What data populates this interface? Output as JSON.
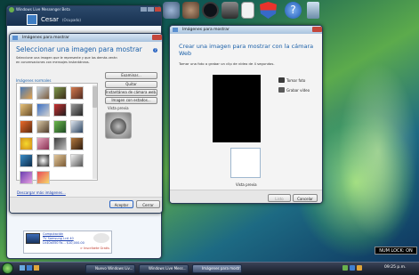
{
  "messenger": {
    "title": "Windows Live Messenger Beta",
    "user_name": "Cesar",
    "user_status": "(Ocupado)",
    "ad_line1": "Computación",
    "ad_line2": "TV Samsung Lcd 40",
    "ad_line3": "Ln40a550 Fa... $10,000.00",
    "ad_line4": "> Inscríbete Gratis"
  },
  "dialog1": {
    "title": "Imágenes para mostrar",
    "heading": "Seleccionar una imagen para mostrar",
    "description": "Seleccione una imagen que le represente y que los demás verán en conversaciones con mensajes instantáneos.",
    "section_label": "Imágenes normales",
    "browse_label": "Examinar...",
    "remove_label": "Quitar",
    "webcam_label": "Instantánea de cámara web...",
    "effects_label": "Imagen con estados...",
    "preview_label": "Vista previa",
    "download_link": "Descargar más imágenes...",
    "accept_label": "Aceptar",
    "cancel_label": "Cerrar"
  },
  "dialog2": {
    "title": "Imágenes para mostrar",
    "heading": "Crear una imagen para mostrar con la cámara Web",
    "description": "Tomar una foto o grabar un clip de vídeo de 4 segundos.",
    "take_photo": "Tomar foto",
    "record_video": "Grabar vídeo",
    "preview_label": "Vista previa",
    "ok_label": "Listo",
    "cancel_label": "Cancelar"
  },
  "taskbar": {
    "task1": "Nuevo Windows Liv...",
    "task2": "Windows Live Mess...",
    "task3": "Imágenes para mostr...",
    "clock": "09:25 p.m."
  },
  "num_lock": "NUM LOCK: ON",
  "colors": {
    "accent": "#1a5fa8",
    "link": "#1a3fb0",
    "taskbar": "#1b2231"
  },
  "icons": {
    "toolbar": [
      "figure-icon",
      "monkey-icon",
      "headphones-icon",
      "camera-icon",
      "document-icon",
      "shield-icon",
      "help-icon",
      "recycle-bin-icon"
    ],
    "thumbnails": [
      "soccer-ball-icon",
      "dog-icon",
      "cat-icon",
      "butterfly-icon",
      "duck-icon",
      "flower-icon",
      "chess-icon",
      "guitar-icon"
    ]
  }
}
